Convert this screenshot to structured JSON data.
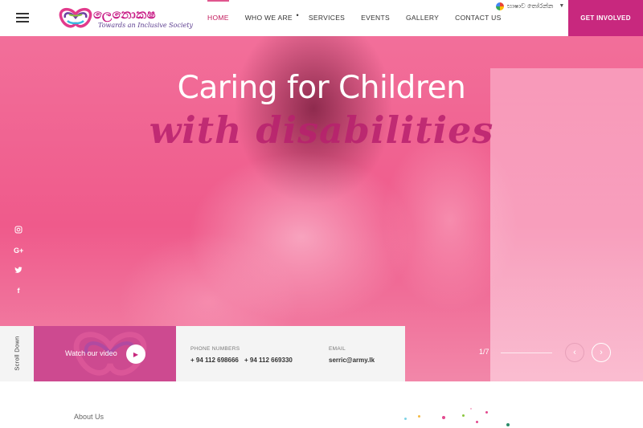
{
  "header": {
    "logo_text": "ලෙනොකෂ",
    "logo_tagline": "Towards an Inclusive Society",
    "nav": [
      {
        "label": "HOME",
        "active": true
      },
      {
        "label": "WHO WE ARE",
        "active": false
      },
      {
        "label": "SERVICES",
        "active": false
      },
      {
        "label": "EVENTS",
        "active": false
      },
      {
        "label": "GALLERY",
        "active": false
      },
      {
        "label": "CONTACT US",
        "active": false
      }
    ],
    "translate_label": "භාෂාව තෝරන්න",
    "cta_label": "GET INVOLVED"
  },
  "hero": {
    "title": "Caring for Children",
    "subtitle": "with disabilities",
    "slide_counter": "1/7",
    "social": [
      "instagram-icon",
      "google-plus-icon",
      "twitter-icon",
      "facebook-icon"
    ]
  },
  "bottom_bar": {
    "scroll_label": "Scroll Down",
    "video_label": "Watch our video",
    "phone_label": "PHONE NUMBERS",
    "phone_1": "+ 94 112 698666",
    "phone_2": "+ 94 112 669330",
    "email_label": "EMAIL",
    "email": "serric@army.lk"
  },
  "about": {
    "heading": "About Us"
  },
  "colors": {
    "brand_magenta": "#c8287e",
    "hero_pink": "#ef5a8b",
    "subtitle_purple": "#b8216e"
  }
}
